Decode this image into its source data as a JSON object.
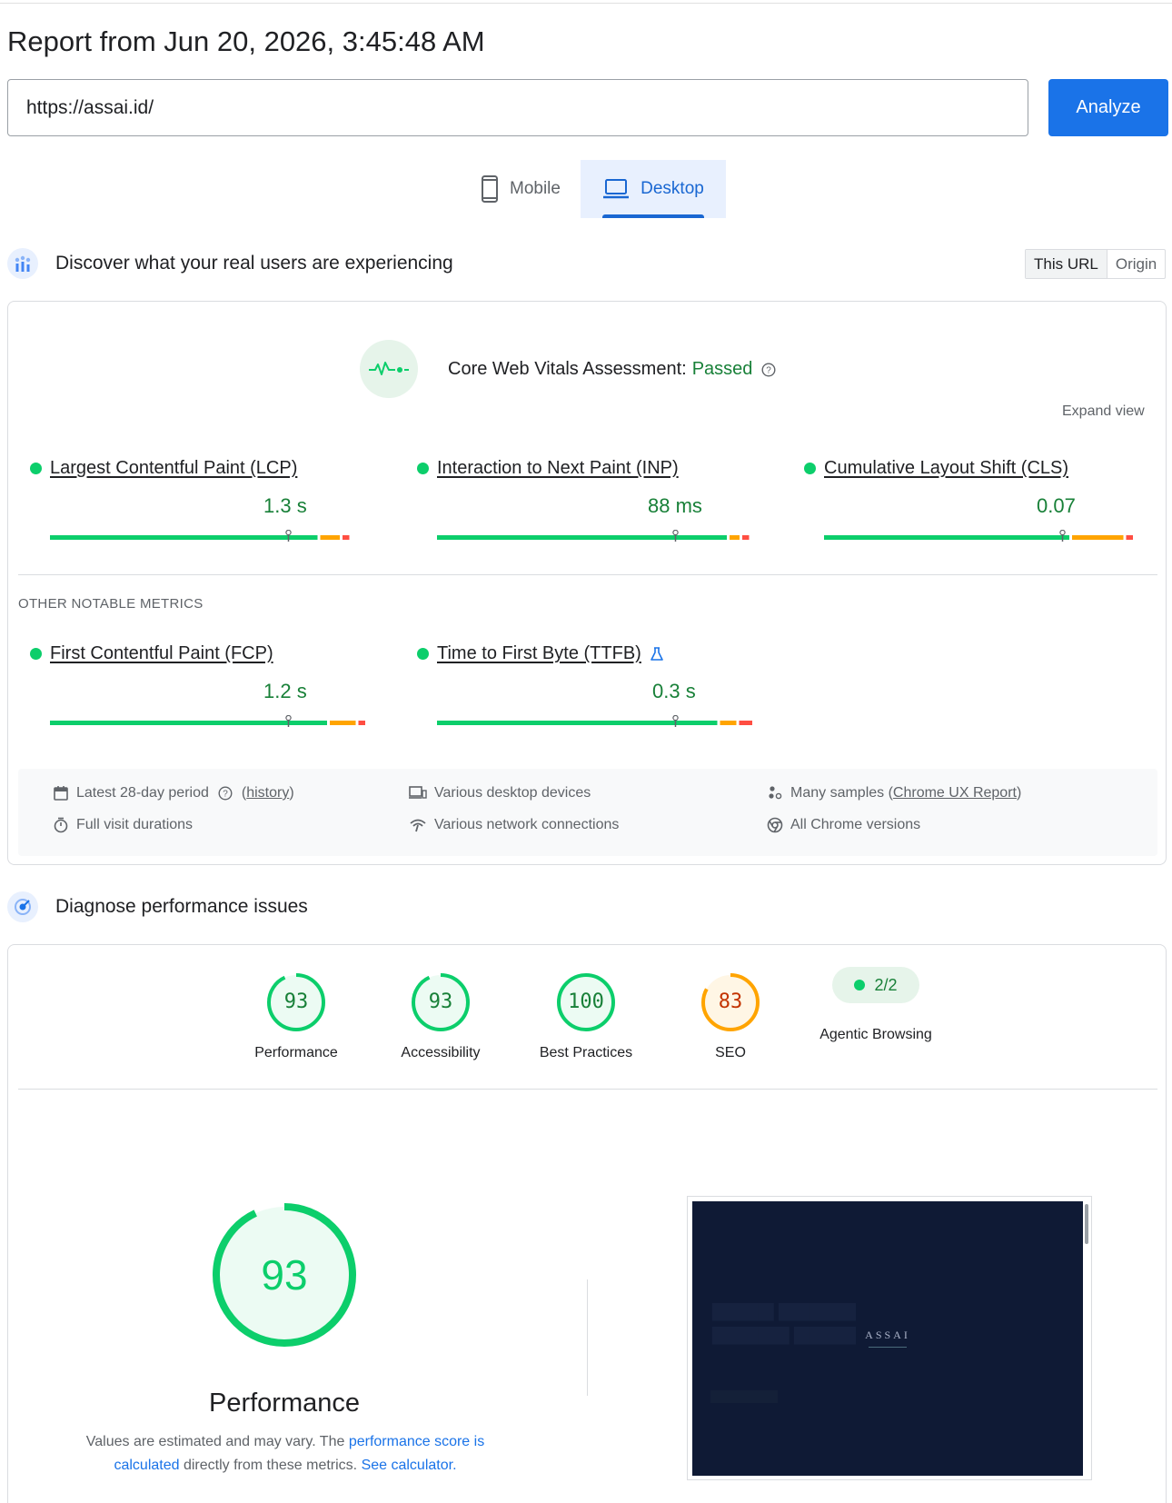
{
  "report": {
    "title": "Report from Jun 20, 2026, 3:45:48 AM"
  },
  "url_bar": {
    "value": "https://assai.id/",
    "analyze_label": "Analyze"
  },
  "tabs": [
    {
      "label": "Mobile",
      "icon": "smartphone-icon",
      "active": false
    },
    {
      "label": "Desktop",
      "icon": "laptop-icon",
      "active": true
    }
  ],
  "field_section": {
    "title": "Discover what your real users are experiencing",
    "toggle": {
      "this_url": "This URL",
      "origin": "Origin",
      "selected": "This URL"
    },
    "assessment_label": "Core Web Vitals Assessment:",
    "assessment_status": "Passed",
    "expand_label": "Expand view",
    "core_metrics": [
      {
        "name": "Largest Contentful Paint (LCP)",
        "value": "1.3 s",
        "status": "good",
        "marker_fraction": 0.75
      },
      {
        "name": "Interaction to Next Paint (INP)",
        "value": "88 ms",
        "status": "good",
        "marker_fraction": 0.75
      },
      {
        "name": "Cumulative Layout Shift (CLS)",
        "value": "0.07",
        "status": "good",
        "marker_fraction": 0.75
      }
    ],
    "other_label": "OTHER NOTABLE METRICS",
    "other_metrics": [
      {
        "name": "First Contentful Paint (FCP)",
        "value": "1.2 s",
        "status": "good",
        "marker_fraction": 0.75
      },
      {
        "name": "Time to First Byte (TTFB)",
        "value": "0.3 s",
        "status": "good",
        "marker_fraction": 0.75,
        "experimental": true
      }
    ],
    "info": {
      "period": "Latest 28-day period",
      "history": "history",
      "devices": "Various desktop devices",
      "samples_prefix": "Many samples (",
      "samples_link": "Chrome UX Report",
      "samples_suffix": ")",
      "durations": "Full visit durations",
      "network": "Various network connections",
      "chrome": "All Chrome versions"
    }
  },
  "diagnose_section": {
    "title": "Diagnose performance issues",
    "scores": [
      {
        "label": "Performance",
        "score": "93",
        "value": 93,
        "rating": "good"
      },
      {
        "label": "Accessibility",
        "score": "93",
        "value": 93,
        "rating": "good"
      },
      {
        "label": "Best Practices",
        "score": "100",
        "value": 100,
        "rating": "good"
      },
      {
        "label": "SEO",
        "score": "83",
        "value": 83,
        "rating": "average"
      }
    ],
    "agentic": {
      "label": "Agentic Browsing",
      "value": "2/2"
    },
    "big": {
      "score": "93",
      "value": 93,
      "label": "Performance",
      "note_1": "Values are estimated and may vary. The ",
      "note_link_1": "performance score is calculated",
      "note_2": " directly from these metrics. ",
      "note_link_2": "See calculator."
    },
    "screenshot": {
      "brand": "ASSAI"
    }
  },
  "colors": {
    "good": "#0cce6b",
    "good_text": "#188038",
    "average": "#ffa400",
    "average_text": "#c33300",
    "poor": "#ff4e42",
    "accent": "#1a73e8"
  }
}
